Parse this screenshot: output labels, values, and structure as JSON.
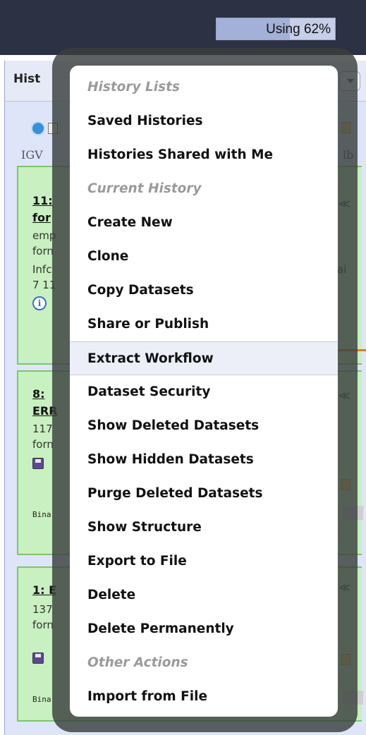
{
  "masthead": {
    "usage_label": "Using 62%",
    "usage_percent": 62
  },
  "history_panel": {
    "title": "Hist",
    "igv_label": "IGV",
    "igv_right_label": "lb",
    "datasets": [
      {
        "title_line1": "11:",
        "title_line2": "for",
        "line1": "emp",
        "line2": "forn",
        "line3": "Infc",
        "line3_right": "ai",
        "line4": "7 11"
      },
      {
        "title_line1": "8:",
        "title_line2": "ERR",
        "line1": "117",
        "line2": "forn",
        "mono_label": "Bina"
      },
      {
        "title_line1": "1: E",
        "line1": "137",
        "line2": "forn",
        "mono_label": "Bina"
      }
    ]
  },
  "menu": {
    "items": [
      {
        "label": "History Lists",
        "type": "header"
      },
      {
        "label": "Saved Histories",
        "type": "item"
      },
      {
        "label": "Histories Shared with Me",
        "type": "item"
      },
      {
        "label": "Current History",
        "type": "header"
      },
      {
        "label": "Create New",
        "type": "item"
      },
      {
        "label": "Clone",
        "type": "item"
      },
      {
        "label": "Copy Datasets",
        "type": "item"
      },
      {
        "label": "Share or Publish",
        "type": "item"
      },
      {
        "label": "Extract Workflow",
        "type": "item",
        "active": true
      },
      {
        "label": "Dataset Security",
        "type": "item"
      },
      {
        "label": "Show Deleted Datasets",
        "type": "item"
      },
      {
        "label": "Show Hidden Datasets",
        "type": "item"
      },
      {
        "label": "Purge Deleted Datasets",
        "type": "item"
      },
      {
        "label": "Show Structure",
        "type": "item"
      },
      {
        "label": "Export to File",
        "type": "item"
      },
      {
        "label": "Delete",
        "type": "item"
      },
      {
        "label": "Delete Permanently",
        "type": "item"
      },
      {
        "label": "Other Actions",
        "type": "header"
      },
      {
        "label": "Import from File",
        "type": "item"
      }
    ]
  },
  "colors": {
    "masthead": "#2c3143",
    "dataset_ok_bg": "#c9f0c0",
    "dataset_ok_border": "#79c86a",
    "menu_header_text": "#9a9a9a",
    "highlight_line": "#e07b1e"
  }
}
